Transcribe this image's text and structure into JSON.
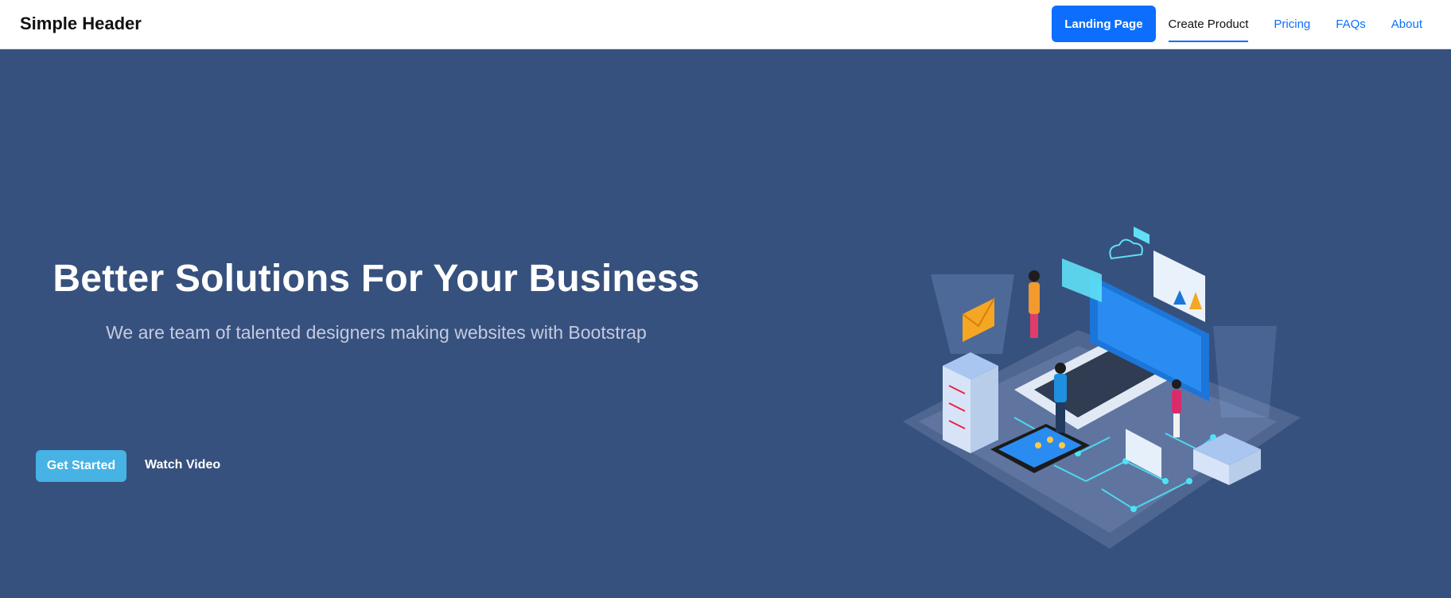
{
  "header": {
    "brand": "Simple Header",
    "nav": [
      {
        "label": "Landing Page"
      },
      {
        "label": "Create Product"
      },
      {
        "label": "Pricing"
      },
      {
        "label": "FAQs"
      },
      {
        "label": "About"
      }
    ]
  },
  "hero": {
    "title": "Better Solutions For Your Business",
    "subtitle": "We are team of talented designers making websites with Bootstrap",
    "primary_button": "Get Started",
    "secondary_button": "Watch Video",
    "illustration": "isometric-tech-illustration"
  },
  "colors": {
    "hero_bg": "#37517e",
    "primary": "#0d6efd",
    "accent": "#47b2e4"
  }
}
